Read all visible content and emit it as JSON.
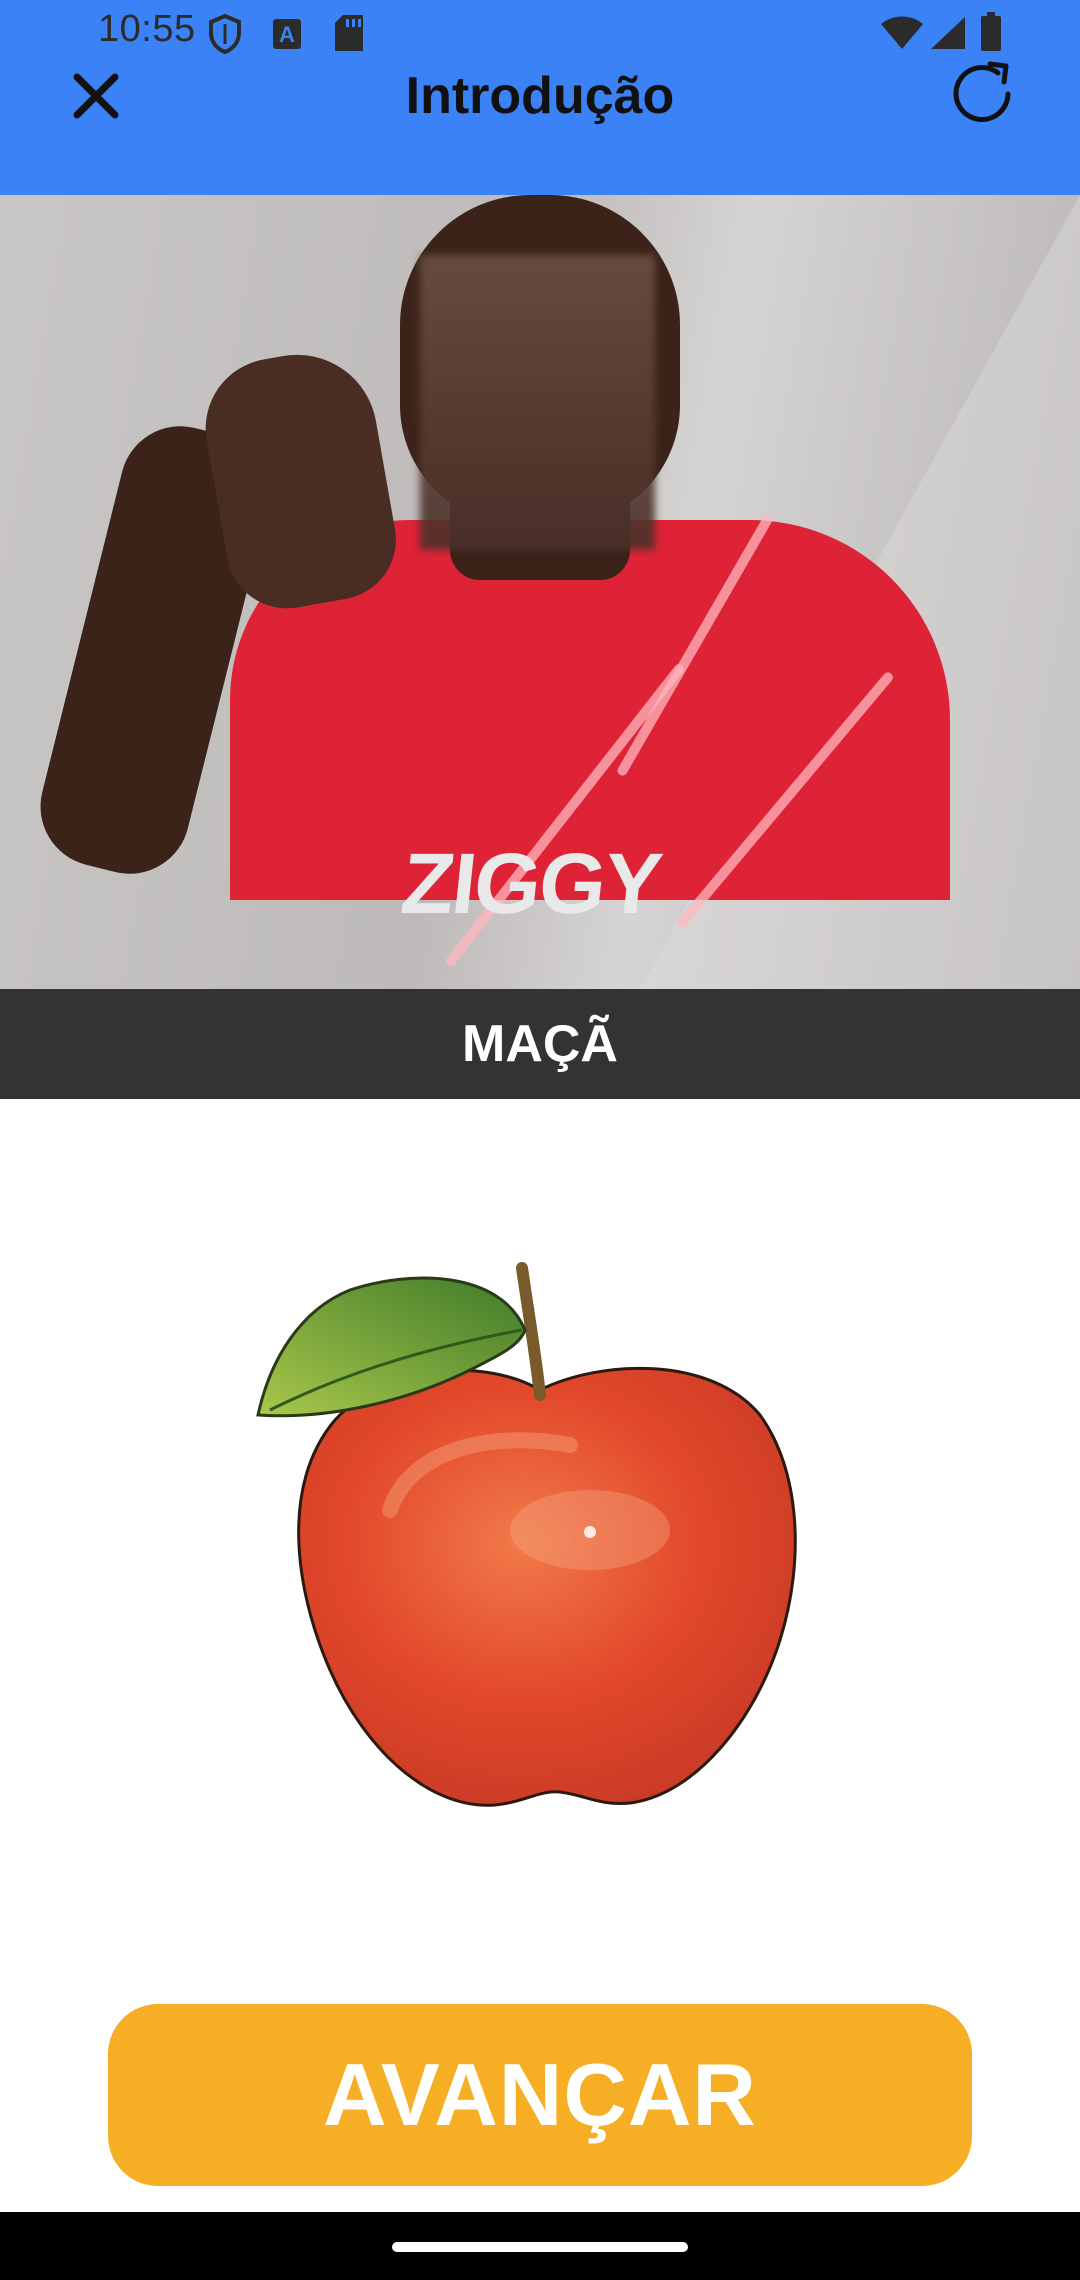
{
  "status_bar": {
    "time": "10:55",
    "left_icons": [
      "shield-icon",
      "text-a-icon",
      "sd-card-icon"
    ],
    "right_icons": [
      "wifi-icon",
      "signal-icon",
      "battery-icon"
    ]
  },
  "toolbar": {
    "title": "Introdução",
    "close_icon": "close-icon",
    "reload_icon": "refresh-icon"
  },
  "video": {
    "shirt_text": "ZIGGY"
  },
  "caption": {
    "word": "MAÇÃ"
  },
  "illustration": {
    "subject": "apple-icon"
  },
  "actions": {
    "advance_label": "AVANÇAR"
  },
  "colors": {
    "header": "#3b82f6",
    "caption_bar": "#333333",
    "advance_button": "#f6ae25",
    "nav_bar": "#000000"
  }
}
